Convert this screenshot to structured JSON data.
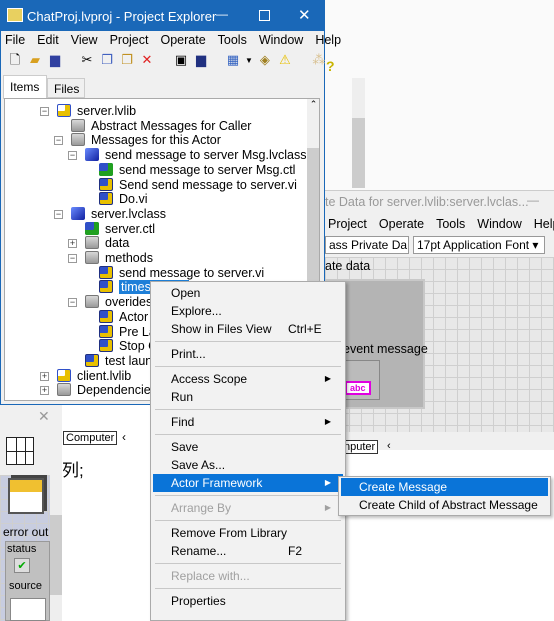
{
  "project_explorer": {
    "title": "ChatProj.lvproj - Project Explorer",
    "menu": [
      "File",
      "Edit",
      "View",
      "Project",
      "Operate",
      "Tools",
      "Window",
      "Help"
    ],
    "tabs": [
      "Items",
      "Files"
    ],
    "tree": [
      {
        "label": "server.lvlib",
        "icon": "library-icon",
        "level": 0,
        "expander": "−"
      },
      {
        "label": "Abstract Messages for Caller",
        "icon": "folder-icon",
        "level": 1
      },
      {
        "label": "Messages for this Actor",
        "icon": "folder-icon",
        "level": 1,
        "expander": "−"
      },
      {
        "label": "send message to server Msg.lvclass",
        "icon": "class-icon",
        "level": 2,
        "expander": "−"
      },
      {
        "label": "send message to server Msg.ctl",
        "icon": "control-icon",
        "level": 3
      },
      {
        "label": "Send send message to server.vi",
        "icon": "vi-icon",
        "level": 3
      },
      {
        "label": "Do.vi",
        "icon": "vi-icon",
        "level": 3
      },
      {
        "label": "server.lvclass",
        "icon": "class-icon",
        "level": 1,
        "expander": "−"
      },
      {
        "label": "server.ctl",
        "icon": "control-icon",
        "level": 2
      },
      {
        "label": "data",
        "icon": "folder-icon",
        "level": 2,
        "expander": "+"
      },
      {
        "label": "methods",
        "icon": "folder-icon",
        "level": 2,
        "expander": "−"
      },
      {
        "label": "send message to server.vi",
        "icon": "vi-icon",
        "level": 3
      },
      {
        "label": "timestr",
        "icon": "vi-icon",
        "level": 3,
        "selected": true
      },
      {
        "label": "overides",
        "icon": "folder-icon",
        "level": 2,
        "expander": "−"
      },
      {
        "label": "Actor C",
        "icon": "vi-icon",
        "level": 3
      },
      {
        "label": "Pre Lau",
        "icon": "vi-icon",
        "level": 3
      },
      {
        "label": "Stop C",
        "icon": "vi-icon",
        "level": 3
      },
      {
        "label": "test launc",
        "icon": "vi-icon",
        "level": 2
      },
      {
        "label": "client.lvlib",
        "icon": "library-icon",
        "level": 0,
        "expander": "+"
      },
      {
        "label": "Dependencies",
        "icon": "dependencies-icon",
        "level": 0,
        "expander": "+"
      }
    ]
  },
  "class_window": {
    "title": "te Data for server.lvlib:server.lvclas...",
    "menu": [
      "Project",
      "Operate",
      "Tools",
      "Window",
      "Help"
    ],
    "combo_class": "ass Private Da",
    "combo_font": "17pt Application Font",
    "cluster_label": "ate data",
    "control_label": "event message",
    "string_indicator": "abc",
    "footer": "nputer"
  },
  "back_window": {
    "footer": "Computer",
    "text": "列;",
    "error_label": "error out",
    "status_label": "status",
    "source_label": "source"
  },
  "context_menu": {
    "items": [
      {
        "label": "Open"
      },
      {
        "label": "Explore..."
      },
      {
        "label": "Show in Files View",
        "shortcut": "Ctrl+E"
      },
      {
        "sep": true
      },
      {
        "label": "Print..."
      },
      {
        "sep": true
      },
      {
        "label": "Access Scope",
        "submenu": true
      },
      {
        "label": "Run"
      },
      {
        "sep": true
      },
      {
        "label": "Find",
        "submenu": true
      },
      {
        "sep": true
      },
      {
        "label": "Save"
      },
      {
        "label": "Save As..."
      },
      {
        "label": "Actor Framework",
        "submenu": true,
        "highlighted": true
      },
      {
        "sep": true
      },
      {
        "label": "Arrange By",
        "submenu": true,
        "disabled": true
      },
      {
        "sep": true
      },
      {
        "label": "Remove From Library"
      },
      {
        "label": "Rename...",
        "shortcut": "F2"
      },
      {
        "sep": true
      },
      {
        "label": "Replace with...",
        "disabled": true
      },
      {
        "sep": true
      },
      {
        "label": "Properties"
      }
    ]
  },
  "submenu": {
    "items": [
      {
        "label": "Create Message",
        "highlighted": true
      },
      {
        "label": "Create Child of Abstract Message"
      }
    ]
  },
  "colors": {
    "titlebar": "#1a68b8",
    "highlight": "#0a74d8",
    "selection": "#1e7fd8"
  }
}
